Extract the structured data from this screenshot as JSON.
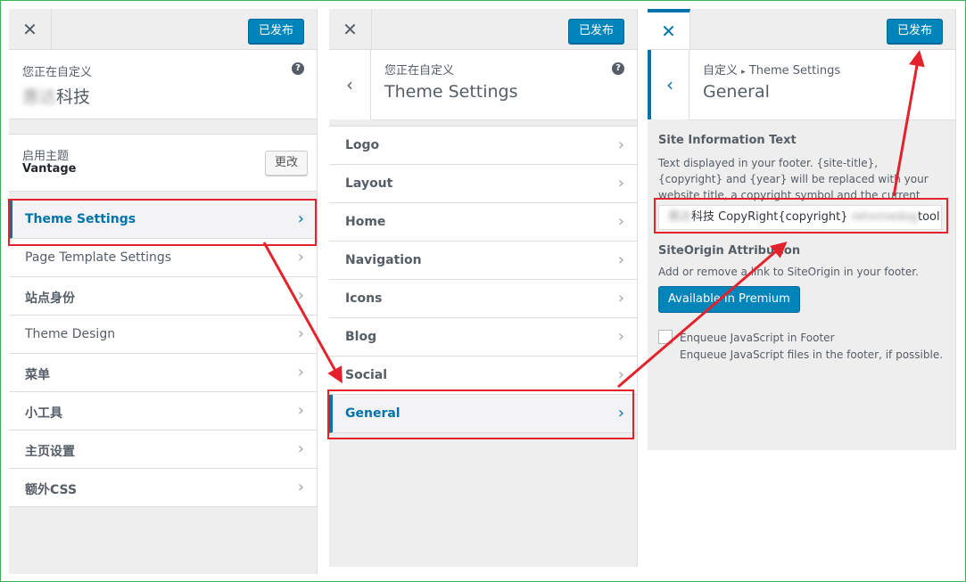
{
  "publish_label": "已发布",
  "panel1": {
    "customizing_label": "您正在自定义",
    "site_title_blurred": "惠达",
    "site_title_suffix": "科技",
    "active_theme_label": "启用主题",
    "theme_name": "Vantage",
    "change_label": "更改",
    "menu_items": [
      {
        "label": "Theme Settings"
      },
      {
        "label": "Page Template Settings"
      },
      {
        "label": "站点身份"
      },
      {
        "label": "Theme Design"
      },
      {
        "label": "菜单"
      },
      {
        "label": "小工具"
      },
      {
        "label": "主页设置"
      },
      {
        "label": "额外CSS"
      }
    ]
  },
  "panel2": {
    "customizing_label": "您正在自定义",
    "title": "Theme Settings",
    "menu_items": [
      {
        "label": "Logo"
      },
      {
        "label": "Layout"
      },
      {
        "label": "Home"
      },
      {
        "label": "Navigation"
      },
      {
        "label": "Icons"
      },
      {
        "label": "Blog"
      },
      {
        "label": "Social"
      },
      {
        "label": "General"
      }
    ]
  },
  "panel3": {
    "breadcrumb_root": "自定义",
    "breadcrumb_separator": "▸",
    "breadcrumb_current": "Theme Settings",
    "title": "General",
    "site_info_title": "Site Information Text",
    "site_info_desc": "Text displayed in your footer. {site-title}, {copyright} and {year} will be replaced with your website title, a copyright symbol and the current year.",
    "site_info_value_blurred_prefix": "惠达",
    "site_info_value_main": "科技 CopyRight{copyright} ",
    "site_info_value_blurred_mid": "rehomedog",
    "site_info_value_suffix": "tool.tc",
    "attribution_title": "SiteOrigin Attribution",
    "attribution_desc": "Add or remove a link to SiteOrigin in your footer.",
    "premium_label": "Available in Premium",
    "enqueue_label": "Enqueue JavaScript in Footer",
    "enqueue_desc": "Enqueue JavaScript files in the footer, if possible."
  },
  "icons": {
    "close": "close-icon",
    "help": "help-icon",
    "back": "chevron-left-icon",
    "item_arrow": "chevron-right-icon"
  },
  "colors": {
    "accent": "#0073aa",
    "publish_button": "#0085ba",
    "annotation_red": "#e4222b",
    "panel_bg": "#eeeeee"
  }
}
